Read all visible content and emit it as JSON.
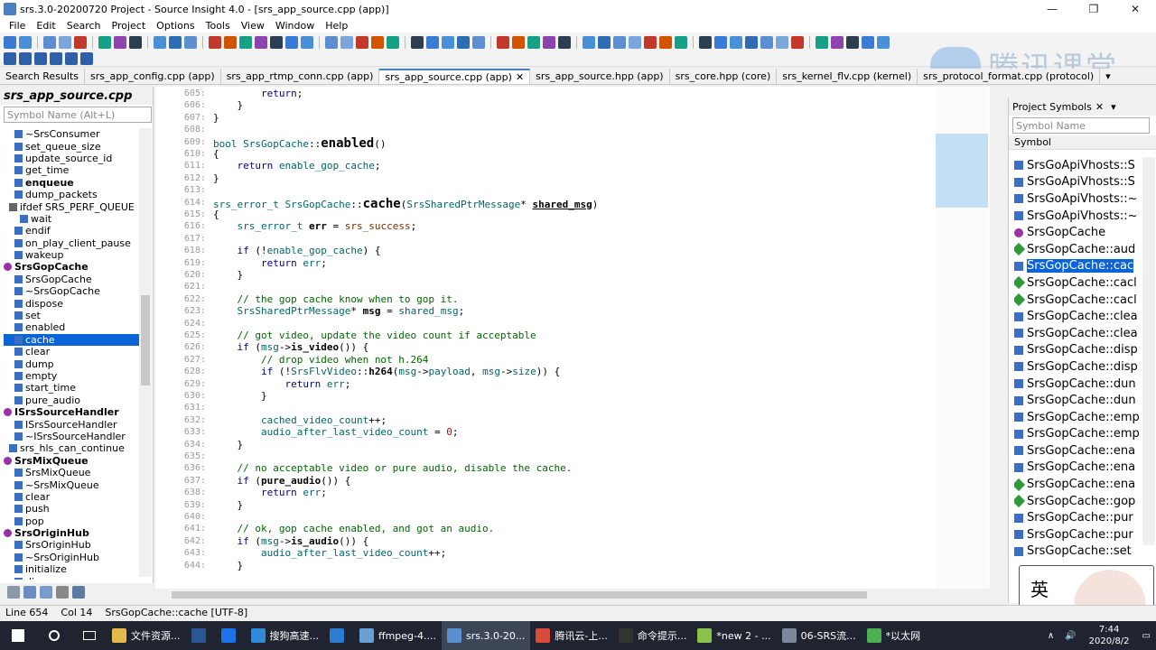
{
  "window": {
    "title": "srs.3.0-20200720 Project - Source Insight 4.0 - [srs_app_source.cpp (app)]",
    "controls": [
      "—",
      "❐",
      "✕"
    ]
  },
  "menu": [
    "File",
    "Edit",
    "Search",
    "Project",
    "Options",
    "Tools",
    "View",
    "Window",
    "Help"
  ],
  "watermark": {
    "text": "腾讯课堂"
  },
  "tabs": [
    {
      "label": "Search Results",
      "active": false
    },
    {
      "label": "srs_app_config.cpp (app)",
      "active": false
    },
    {
      "label": "srs_app_rtmp_conn.cpp (app)",
      "active": false
    },
    {
      "label": "srs_app_source.cpp (app)",
      "active": true,
      "close": "✕"
    },
    {
      "label": "srs_app_source.hpp (app)",
      "active": false
    },
    {
      "label": "srs_core.hpp (core)",
      "active": false
    },
    {
      "label": "srs_kernel_flv.cpp (kernel)",
      "active": false
    },
    {
      "label": "srs_protocol_format.cpp (protocol)",
      "active": false
    }
  ],
  "tab_overflow": "▾",
  "left_panel": {
    "title": "srs_app_source.cpp",
    "search_placeholder": "Symbol Name (Alt+L)",
    "symbols": [
      {
        "text": "~SrsConsumer",
        "indent": 2,
        "icon": "method-icon",
        "bold": false
      },
      {
        "text": "set_queue_size",
        "indent": 2,
        "icon": "method-icon",
        "bold": false
      },
      {
        "text": "update_source_id",
        "indent": 2,
        "icon": "method-icon",
        "bold": false
      },
      {
        "text": "get_time",
        "indent": 2,
        "icon": "method-icon",
        "bold": false
      },
      {
        "text": "enqueue",
        "indent": 2,
        "icon": "method-icon",
        "bold": true
      },
      {
        "text": "dump_packets",
        "indent": 2,
        "icon": "method-icon",
        "bold": false
      },
      {
        "text": "ifdef SRS_PERF_QUEUE",
        "indent": 1,
        "icon": "ifdef-icon",
        "bold": false
      },
      {
        "text": "wait",
        "indent": 3,
        "icon": "method-icon",
        "bold": false
      },
      {
        "text": "endif",
        "indent": 2,
        "icon": "method-icon",
        "bold": false
      },
      {
        "text": "on_play_client_pause",
        "indent": 2,
        "icon": "method-icon",
        "bold": false
      },
      {
        "text": "wakeup",
        "indent": 2,
        "icon": "method-icon",
        "bold": false
      },
      {
        "text": "SrsGopCache",
        "indent": 0,
        "icon": "class-icon",
        "bold": true
      },
      {
        "text": "SrsGopCache",
        "indent": 2,
        "icon": "method-icon",
        "bold": false
      },
      {
        "text": "~SrsGopCache",
        "indent": 2,
        "icon": "method-icon",
        "bold": false
      },
      {
        "text": "dispose",
        "indent": 2,
        "icon": "method-icon",
        "bold": false
      },
      {
        "text": "set",
        "indent": 2,
        "icon": "method-icon",
        "bold": false
      },
      {
        "text": "enabled",
        "indent": 2,
        "icon": "method-icon",
        "bold": false
      },
      {
        "text": "cache",
        "indent": 2,
        "icon": "method-icon",
        "bold": false,
        "selected": true
      },
      {
        "text": "clear",
        "indent": 2,
        "icon": "method-icon",
        "bold": false
      },
      {
        "text": "dump",
        "indent": 2,
        "icon": "method-icon",
        "bold": false
      },
      {
        "text": "empty",
        "indent": 2,
        "icon": "method-icon",
        "bold": false
      },
      {
        "text": "start_time",
        "indent": 2,
        "icon": "method-icon",
        "bold": false
      },
      {
        "text": "pure_audio",
        "indent": 2,
        "icon": "method-icon",
        "bold": false
      },
      {
        "text": "ISrsSourceHandler",
        "indent": 0,
        "icon": "class-icon",
        "bold": true
      },
      {
        "text": "ISrsSourceHandler",
        "indent": 2,
        "icon": "method-icon",
        "bold": false
      },
      {
        "text": "~ISrsSourceHandler",
        "indent": 2,
        "icon": "method-icon",
        "bold": false
      },
      {
        "text": "srs_hls_can_continue",
        "indent": 1,
        "icon": "function-icon",
        "bold": false
      },
      {
        "text": "SrsMixQueue",
        "indent": 0,
        "icon": "class-icon",
        "bold": true
      },
      {
        "text": "SrsMixQueue",
        "indent": 2,
        "icon": "method-icon",
        "bold": false
      },
      {
        "text": "~SrsMixQueue",
        "indent": 2,
        "icon": "method-icon",
        "bold": false
      },
      {
        "text": "clear",
        "indent": 2,
        "icon": "method-icon",
        "bold": false
      },
      {
        "text": "push",
        "indent": 2,
        "icon": "method-icon",
        "bold": false
      },
      {
        "text": "pop",
        "indent": 2,
        "icon": "method-icon",
        "bold": false
      },
      {
        "text": "SrsOriginHub",
        "indent": 0,
        "icon": "class-icon",
        "bold": true
      },
      {
        "text": "SrsOriginHub",
        "indent": 2,
        "icon": "method-icon",
        "bold": false
      },
      {
        "text": "~SrsOriginHub",
        "indent": 2,
        "icon": "method-icon",
        "bold": false
      },
      {
        "text": "initialize",
        "indent": 2,
        "icon": "method-icon",
        "bold": false
      },
      {
        "text": "dispose",
        "indent": 2,
        "icon": "method-icon",
        "bold": false
      }
    ]
  },
  "editor": {
    "lines": [
      {
        "n": "605:",
        "html": "        <span class='kw'>return</span>;"
      },
      {
        "n": "606:",
        "html": "    }"
      },
      {
        "n": "607:",
        "html": "}"
      },
      {
        "n": "608:",
        "html": ""
      },
      {
        "n": "609:",
        "html": "<span class='ty'>bool</span> <span class='ty'>SrsGopCache</span>::<span class='fnbig'>enabled</span>()"
      },
      {
        "n": "610:",
        "html": "{"
      },
      {
        "n": "611:",
        "html": "    <span class='kw'>return</span> <span class='ty'>enable_gop_cache</span>;"
      },
      {
        "n": "612:",
        "html": "}"
      },
      {
        "n": "613:",
        "html": ""
      },
      {
        "n": "614:",
        "html": "<span class='ty'>srs_error_t</span> <span class='ty'>SrsGopCache</span>::<span class='fnbig'>cache</span>(<span class='ty'>SrsSharedPtrMessage</span>* <span class='fn' style='text-decoration:underline'>shared_msg</span>)"
      },
      {
        "n": "615:",
        "html": "{"
      },
      {
        "n": "616:",
        "html": "    <span class='ty'>srs_error_t</span> <span class='fn'>err</span> = <span class='var'>srs_success</span>;"
      },
      {
        "n": "617:",
        "html": ""
      },
      {
        "n": "618:",
        "html": "    <span class='kw'>if</span> (!<span class='ty'>enable_gop_cache</span>) {"
      },
      {
        "n": "619:",
        "html": "        <span class='kw'>return</span> <span class='ty'>err</span>;"
      },
      {
        "n": "620:",
        "html": "    }"
      },
      {
        "n": "621:",
        "html": ""
      },
      {
        "n": "622:",
        "html": "    <span class='cm'>// the gop cache know when to gop it.</span>"
      },
      {
        "n": "623:",
        "html": "    <span class='ty'>SrsSharedPtrMessage</span>* <span class='fn'>msg</span> = <span class='ty'>shared_msg</span>;"
      },
      {
        "n": "624:",
        "html": ""
      },
      {
        "n": "625:",
        "html": "    <span class='cm'>// got video, update the video count if acceptable</span>"
      },
      {
        "n": "626:",
        "html": "    <span class='kw'>if</span> (<span class='ty'>msg</span>-><span class='fn'>is_video</span>()) {"
      },
      {
        "n": "627:",
        "html": "        <span class='cm'>// drop video when not h.264</span>"
      },
      {
        "n": "628:",
        "html": "        <span class='kw'>if</span> (!<span class='ty'>SrsFlvVideo</span>::<span class='fn'>h264</span>(<span class='ty'>msg</span>-><span class='ty'>payload</span>, <span class='ty'>msg</span>-><span class='ty'>size</span>)) {"
      },
      {
        "n": "629:",
        "html": "            <span class='kw'>return</span> <span class='ty'>err</span>;"
      },
      {
        "n": "630:",
        "html": "        }"
      },
      {
        "n": "631:",
        "html": ""
      },
      {
        "n": "632:",
        "html": "        <span class='ty'>cached_video_count</span>++;"
      },
      {
        "n": "633:",
        "html": "        <span class='ty'>audio_after_last_video_count</span> = <span class='num'>0</span>;"
      },
      {
        "n": "634:",
        "html": "    }"
      },
      {
        "n": "635:",
        "html": ""
      },
      {
        "n": "636:",
        "html": "    <span class='cm'>// no acceptable video or pure audio, disable the cache.</span>"
      },
      {
        "n": "637:",
        "html": "    <span class='kw'>if</span> (<span class='fn'>pure_audio</span>()) {"
      },
      {
        "n": "638:",
        "html": "        <span class='kw'>return</span> <span class='ty'>err</span>;"
      },
      {
        "n": "639:",
        "html": "    }"
      },
      {
        "n": "640:",
        "html": ""
      },
      {
        "n": "641:",
        "html": "    <span class='cm'>// ok, gop cache enabled, and got an audio.</span>"
      },
      {
        "n": "642:",
        "html": "    <span class='kw'>if</span> (<span class='ty'>msg</span>-><span class='fn'>is_audio</span>()) {"
      },
      {
        "n": "643:",
        "html": "        <span class='ty'>audio_after_last_video_count</span>++;"
      },
      {
        "n": "644:",
        "html": "    }"
      }
    ]
  },
  "right_panel": {
    "title": "Project Symbols",
    "search_placeholder": "Symbol Name",
    "column": "Symbol",
    "symbols": [
      {
        "text": "SrsGoApiVhosts::S",
        "icon": "method-icon"
      },
      {
        "text": "SrsGoApiVhosts::S",
        "icon": "method-icon"
      },
      {
        "text": "SrsGoApiVhosts::~",
        "icon": "method-icon"
      },
      {
        "text": "SrsGoApiVhosts::~",
        "icon": "method-icon"
      },
      {
        "text": "SrsGopCache",
        "icon": "class-icon"
      },
      {
        "text": "SrsGopCache::aud",
        "icon": "member-icon"
      },
      {
        "text": "SrsGopCache::cac",
        "icon": "method-icon",
        "selected": true
      },
      {
        "text": "SrsGopCache::cacl",
        "icon": "member-icon"
      },
      {
        "text": "SrsGopCache::cacl",
        "icon": "member-icon"
      },
      {
        "text": "SrsGopCache::clea",
        "icon": "method-icon"
      },
      {
        "text": "SrsGopCache::clea",
        "icon": "method-icon"
      },
      {
        "text": "SrsGopCache::disp",
        "icon": "method-icon"
      },
      {
        "text": "SrsGopCache::disp",
        "icon": "method-icon"
      },
      {
        "text": "SrsGopCache::dun",
        "icon": "method-icon"
      },
      {
        "text": "SrsGopCache::dun",
        "icon": "method-icon"
      },
      {
        "text": "SrsGopCache::emp",
        "icon": "method-icon"
      },
      {
        "text": "SrsGopCache::emp",
        "icon": "method-icon"
      },
      {
        "text": "SrsGopCache::ena",
        "icon": "method-icon"
      },
      {
        "text": "SrsGopCache::ena",
        "icon": "method-icon"
      },
      {
        "text": "SrsGopCache::ena",
        "icon": "member-icon"
      },
      {
        "text": "SrsGopCache::gop",
        "icon": "member-icon"
      },
      {
        "text": "SrsGopCache::pur",
        "icon": "method-icon"
      },
      {
        "text": "SrsGopCache::pur",
        "icon": "method-icon"
      },
      {
        "text": "SrsGopCache::set",
        "icon": "method-icon"
      }
    ]
  },
  "status": {
    "line": "Line 654",
    "col": "Col 14",
    "symbol": "SrsGopCache::cache [UTF-8]"
  },
  "taskbar": {
    "items": [
      {
        "label": "文件资源...",
        "color": "#e8b84a",
        "active": false
      },
      {
        "label": "",
        "color": "#2b5797",
        "active": false
      },
      {
        "label": "",
        "color": "#1a73e8",
        "active": false
      },
      {
        "label": "搜狗高速...",
        "color": "#2f8ad8",
        "active": false
      },
      {
        "label": "",
        "color": "#2b7cd3",
        "active": false
      },
      {
        "label": "ffmpeg-4....",
        "color": "#6aa0d8",
        "active": false
      },
      {
        "label": "srs.3.0-20...",
        "color": "#5a8fd0",
        "active": true
      },
      {
        "label": "腾讯云-上...",
        "color": "#d84a3a",
        "active": false
      },
      {
        "label": "命令提示...",
        "color": "#333333",
        "active": false
      },
      {
        "label": "*new 2 - ...",
        "color": "#8bc34a",
        "active": false
      },
      {
        "label": "06-SRS流...",
        "color": "#7a8a9a",
        "active": false
      },
      {
        "label": "*以太网",
        "color": "#4caf50",
        "active": false
      }
    ],
    "time": "7:44",
    "date": "2020/8/2"
  },
  "overlay": {
    "text": "英"
  },
  "colors": {
    "selection": "#0a64d8",
    "comment": "#006600",
    "keyword": "#00008b"
  }
}
